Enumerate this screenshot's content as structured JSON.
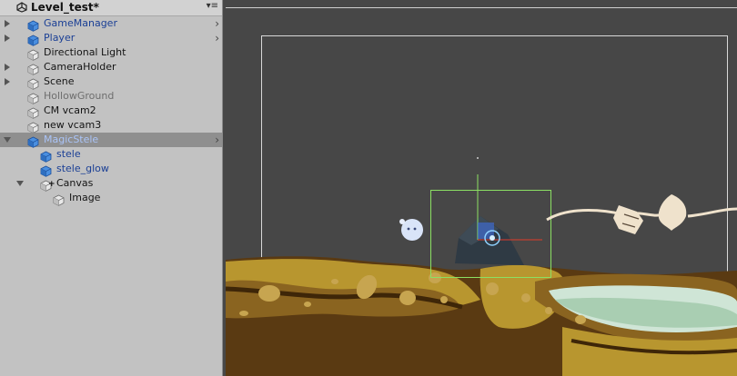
{
  "hierarchy": {
    "scene_title": "Level_test*",
    "menu_glyph": "▾≡",
    "items": [
      {
        "label": "GameManager",
        "type": "prefab",
        "fold": "closed",
        "indent": 0,
        "chevron": true,
        "selected": false
      },
      {
        "label": "Player",
        "type": "prefab",
        "fold": "closed",
        "indent": 0,
        "chevron": true,
        "selected": false
      },
      {
        "label": "Directional Light",
        "type": "normal",
        "fold": "none",
        "indent": 0,
        "chevron": false,
        "selected": false
      },
      {
        "label": "CameraHolder",
        "type": "normal",
        "fold": "closed",
        "indent": 0,
        "chevron": false,
        "selected": false
      },
      {
        "label": "Scene",
        "type": "normal",
        "fold": "closed",
        "indent": 0,
        "chevron": false,
        "selected": false
      },
      {
        "label": "HollowGround",
        "type": "inactive",
        "fold": "none",
        "indent": 0,
        "chevron": false,
        "selected": false
      },
      {
        "label": "CM vcam2",
        "type": "normal",
        "fold": "none",
        "indent": 0,
        "chevron": false,
        "selected": false
      },
      {
        "label": "new vcam3",
        "type": "normal",
        "fold": "none",
        "indent": 0,
        "chevron": false,
        "selected": false
      },
      {
        "label": "MagicStele",
        "type": "selprefab",
        "fold": "open",
        "indent": 0,
        "chevron": true,
        "selected": true
      },
      {
        "label": "stele",
        "type": "prefab",
        "fold": "none",
        "indent": 1,
        "chevron": false,
        "selected": false
      },
      {
        "label": "stele_glow",
        "type": "prefab",
        "fold": "none",
        "indent": 1,
        "chevron": false,
        "selected": false
      },
      {
        "label": "Canvas",
        "type": "normal",
        "fold": "open",
        "indent": 1,
        "chevron": false,
        "selected": false,
        "plus": true
      },
      {
        "label": "Image",
        "type": "normal",
        "fold": "none",
        "indent": 2,
        "chevron": false,
        "selected": false
      }
    ],
    "chevron_glyph": "›"
  },
  "scene": {
    "icons": [
      "unity-logo-icon",
      "cube-icon",
      "prefab-cube-icon",
      "move-gizmo-icon",
      "camera-frame",
      "rect-transform-frame"
    ],
    "colors": {
      "background": "#474747",
      "ground_dark": "#5a3a12",
      "ground_mid": "#8a6420",
      "ground_light": "#b8962f",
      "water": "#cfe5d6",
      "selection_green": "#8ce063",
      "gizmo_red": "#e23b2a",
      "gizmo_blue": "#3f6ee0"
    }
  }
}
